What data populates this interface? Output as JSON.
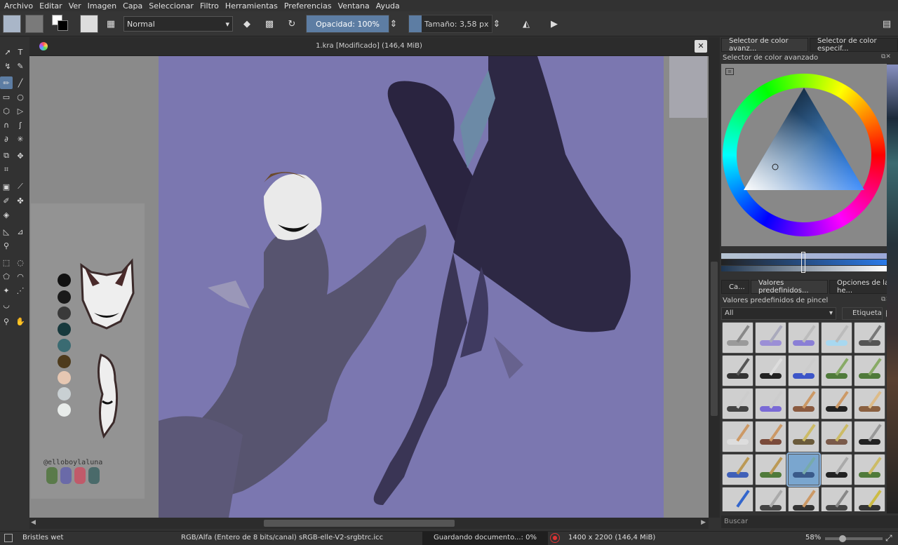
{
  "menu": [
    "Archivo",
    "Editar",
    "Ver",
    "Imagen",
    "Capa",
    "Seleccionar",
    "Filtro",
    "Herramientas",
    "Preferencias",
    "Ventana",
    "Ayuda"
  ],
  "toolbar": {
    "blend_mode": "Normal",
    "opacity_label": "Opacidad:",
    "opacity_value": "100%",
    "size_label": "Tamaño:",
    "size_value": "3,58 px"
  },
  "document": {
    "title": "1.kra [Modificado]  (146,4 MiB)"
  },
  "reference": {
    "handle": "@elloboylaluna",
    "colors": [
      "#111111",
      "#1a1a1a",
      "#3a3a3a",
      "#17393d",
      "#3a6b72",
      "#4e3b1c",
      "#e6c7b2",
      "#c9d0d3",
      "#e8ecea"
    ]
  },
  "right_panel": {
    "tabs_top": [
      "Selector de color avanz...",
      "Selector de color especif..."
    ],
    "color_panel_title": "Selector de color avanzado",
    "tabs_mid": [
      "Ca...",
      "Valores predefinidos...",
      "Opciones de la he..."
    ],
    "brush_panel_title": "Valores predefinidos de pincel",
    "filter_value": "All",
    "tag_label": "Etiqueta",
    "search_placeholder": "Buscar",
    "brushes": [
      {
        "stroke": "#9a9a9a",
        "nib": "#888"
      },
      {
        "stroke": "#9b8fd6",
        "nib": "#aab"
      },
      {
        "stroke": "#8a7fd6",
        "nib": "#bbb"
      },
      {
        "stroke": "#a8d8f0",
        "nib": "#bbb"
      },
      {
        "stroke": "#555",
        "nib": "#777"
      },
      {
        "stroke": "#333",
        "nib": "#555"
      },
      {
        "stroke": "#222",
        "nib": "#ddd"
      },
      {
        "stroke": "#3c55c8",
        "nib": "#ccc"
      },
      {
        "stroke": "#4f7a3a",
        "nib": "#8a6"
      },
      {
        "stroke": "#4f7a3a",
        "nib": "#8a6"
      },
      {
        "stroke": "#444",
        "nib": "#ccc"
      },
      {
        "stroke": "#7a6ad6",
        "nib": "#ccc"
      },
      {
        "stroke": "#8a5a40",
        "nib": "#c96"
      },
      {
        "stroke": "#222",
        "nib": "#c96"
      },
      {
        "stroke": "#8a6040",
        "nib": "#db8"
      },
      {
        "stroke": "#ddd",
        "nib": "#c96"
      },
      {
        "stroke": "#7a4a3a",
        "nib": "#c96"
      },
      {
        "stroke": "#6a5a3a",
        "nib": "#cb6"
      },
      {
        "stroke": "#7a5a4a",
        "nib": "#cb6"
      },
      {
        "stroke": "#222",
        "nib": "#999"
      },
      {
        "stroke": "#4060b8",
        "nib": "#b95"
      },
      {
        "stroke": "#4f7a3a",
        "nib": "#b95"
      },
      {
        "stroke": "#3a5a8a",
        "nib": "#7aa"
      },
      {
        "stroke": "#222",
        "nib": "#aaa"
      },
      {
        "stroke": "#4f7a3a",
        "nib": "#cb6"
      },
      {
        "stroke": "#cfcfcf",
        "nib": "#36c"
      },
      {
        "stroke": "#444",
        "nib": "#aaa"
      },
      {
        "stroke": "#333",
        "nib": "#c96"
      },
      {
        "stroke": "#444",
        "nib": "#888"
      },
      {
        "stroke": "#333",
        "nib": "#cb4"
      }
    ]
  },
  "status": {
    "brush_name": "Bristles wet",
    "color_space": "RGB/Alfa (Entero de 8 bits/canal)  sRGB-elle-V2-srgbtrc.icc",
    "saving": "Guardando documento...: 0%",
    "dimensions": "1400 x 2200 (146,4 MiB)",
    "zoom": "58%"
  }
}
